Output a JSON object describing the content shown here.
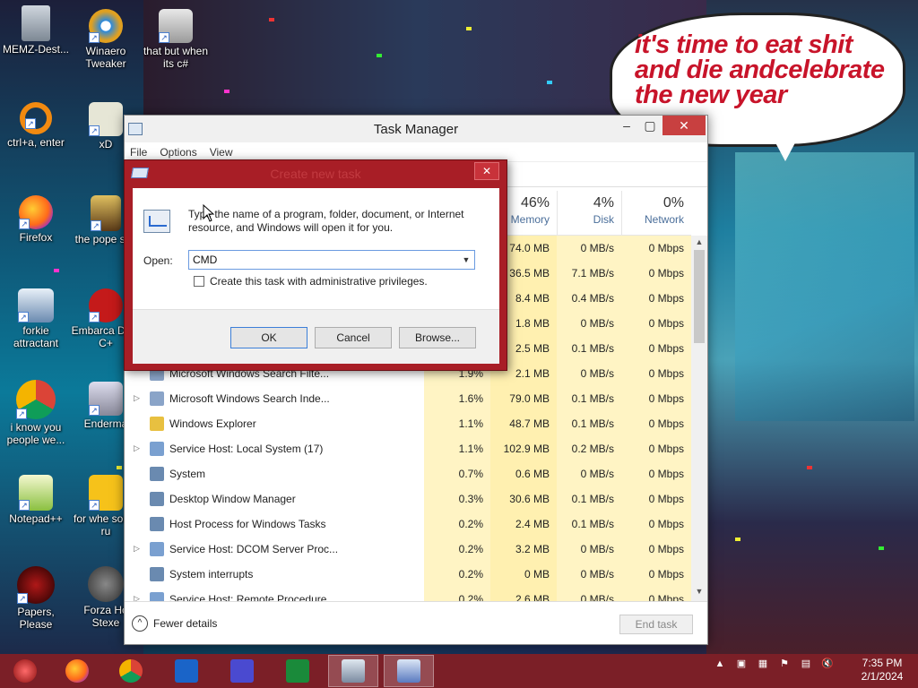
{
  "desktop": {
    "icons": [
      {
        "label": "MEMZ-Dest...",
        "icon": "recycle-bin-icon"
      },
      {
        "label": "Winaero Tweaker",
        "icon": "winaero-icon"
      },
      {
        "label": "that but when its c#",
        "icon": "windows-stack-icon"
      },
      {
        "label": "ctrl+a, enter",
        "icon": "orange-ring-icon"
      },
      {
        "label": "xD",
        "icon": "hxd-icon"
      },
      {
        "label": "Firefox",
        "icon": "firefox-icon"
      },
      {
        "label": "the pope shit",
        "icon": "media-file-icon"
      },
      {
        "label": "forkie attractant",
        "icon": "control-panel-icon"
      },
      {
        "label": "Embarca Dev-C+",
        "icon": "devcpp-icon"
      },
      {
        "label": "i know you people we...",
        "icon": "chrome-icon"
      },
      {
        "label": "Enderma",
        "icon": "terminal-icon"
      },
      {
        "label": "Notepad++",
        "icon": "notepadpp-icon"
      },
      {
        "label": "for whe some ru",
        "icon": "yellow-di-icon"
      },
      {
        "label": "Papers, Please",
        "icon": "papers-please-icon"
      },
      {
        "label": "Forza Ho Stexe",
        "icon": "flash-icon"
      }
    ],
    "bubble_text": "it's time to eat shit and die andcelebrate the new year"
  },
  "task_manager": {
    "title": "Task Manager",
    "menu": [
      "File",
      "Options",
      "View"
    ],
    "columns": {
      "memory": {
        "percent": "46%",
        "label": "Memory"
      },
      "disk": {
        "percent": "4%",
        "label": "Disk"
      },
      "network": {
        "percent": "0%",
        "label": "Network"
      }
    },
    "rows": [
      {
        "name": "",
        "cpu": "",
        "memory": "74.0 MB",
        "disk": "0 MB/s",
        "network": "0 Mbps",
        "expand": false
      },
      {
        "name": "",
        "cpu": "",
        "memory": "36.5 MB",
        "disk": "7.1 MB/s",
        "network": "0 Mbps",
        "expand": false
      },
      {
        "name": "",
        "cpu": "",
        "memory": "8.4 MB",
        "disk": "0.4 MB/s",
        "network": "0 Mbps",
        "expand": false
      },
      {
        "name": "",
        "cpu": "",
        "memory": "1.8 MB",
        "disk": "0 MB/s",
        "network": "0 Mbps",
        "expand": false
      },
      {
        "name": "",
        "cpu": "",
        "memory": "2.5 MB",
        "disk": "0.1 MB/s",
        "network": "0 Mbps",
        "expand": false
      },
      {
        "name": "Microsoft Windows Search Filte...",
        "cpu": "1.9%",
        "memory": "2.1 MB",
        "disk": "0 MB/s",
        "network": "0 Mbps",
        "expand": false
      },
      {
        "name": "Microsoft Windows Search Inde...",
        "cpu": "1.6%",
        "memory": "79.0 MB",
        "disk": "0.1 MB/s",
        "network": "0 Mbps",
        "expand": true
      },
      {
        "name": "Windows Explorer",
        "cpu": "1.1%",
        "memory": "48.7 MB",
        "disk": "0.1 MB/s",
        "network": "0 Mbps",
        "expand": false
      },
      {
        "name": "Service Host: Local System (17)",
        "cpu": "1.1%",
        "memory": "102.9 MB",
        "disk": "0.2 MB/s",
        "network": "0 Mbps",
        "expand": true
      },
      {
        "name": "System",
        "cpu": "0.7%",
        "memory": "0.6 MB",
        "disk": "0 MB/s",
        "network": "0 Mbps",
        "expand": false
      },
      {
        "name": "Desktop Window Manager",
        "cpu": "0.3%",
        "memory": "30.6 MB",
        "disk": "0.1 MB/s",
        "network": "0 Mbps",
        "expand": false
      },
      {
        "name": "Host Process for Windows Tasks",
        "cpu": "0.2%",
        "memory": "2.4 MB",
        "disk": "0.1 MB/s",
        "network": "0 Mbps",
        "expand": false
      },
      {
        "name": "Service Host: DCOM Server Proc...",
        "cpu": "0.2%",
        "memory": "3.2 MB",
        "disk": "0 MB/s",
        "network": "0 Mbps",
        "expand": true
      },
      {
        "name": "System interrupts",
        "cpu": "0.2%",
        "memory": "0 MB",
        "disk": "0 MB/s",
        "network": "0 Mbps",
        "expand": false
      },
      {
        "name": "Service Host: Remote Procedure...",
        "cpu": "0.2%",
        "memory": "2.6 MB",
        "disk": "0 MB/s",
        "network": "0 Mbps",
        "expand": true
      }
    ],
    "fewer_details": "Fewer details",
    "end_task": "End task"
  },
  "dialog": {
    "title": "Create new task",
    "message": "Type the name of a program, folder, document, or Internet resource, and Windows will open it for you.",
    "open_label": "Open:",
    "open_value": "CMD",
    "admin_label": "Create this task with administrative privileges.",
    "ok": "OK",
    "cancel": "Cancel",
    "browse": "Browse..."
  },
  "taskbar": {
    "items": [
      "start-orb-icon",
      "firefox-icon",
      "chrome-icon",
      "outlook-icon",
      "settings-gear-icon",
      "excel-icon",
      "task-manager-icon",
      "run-dialog-icon"
    ],
    "time": "7:35 PM",
    "date": "2/1/2024"
  }
}
